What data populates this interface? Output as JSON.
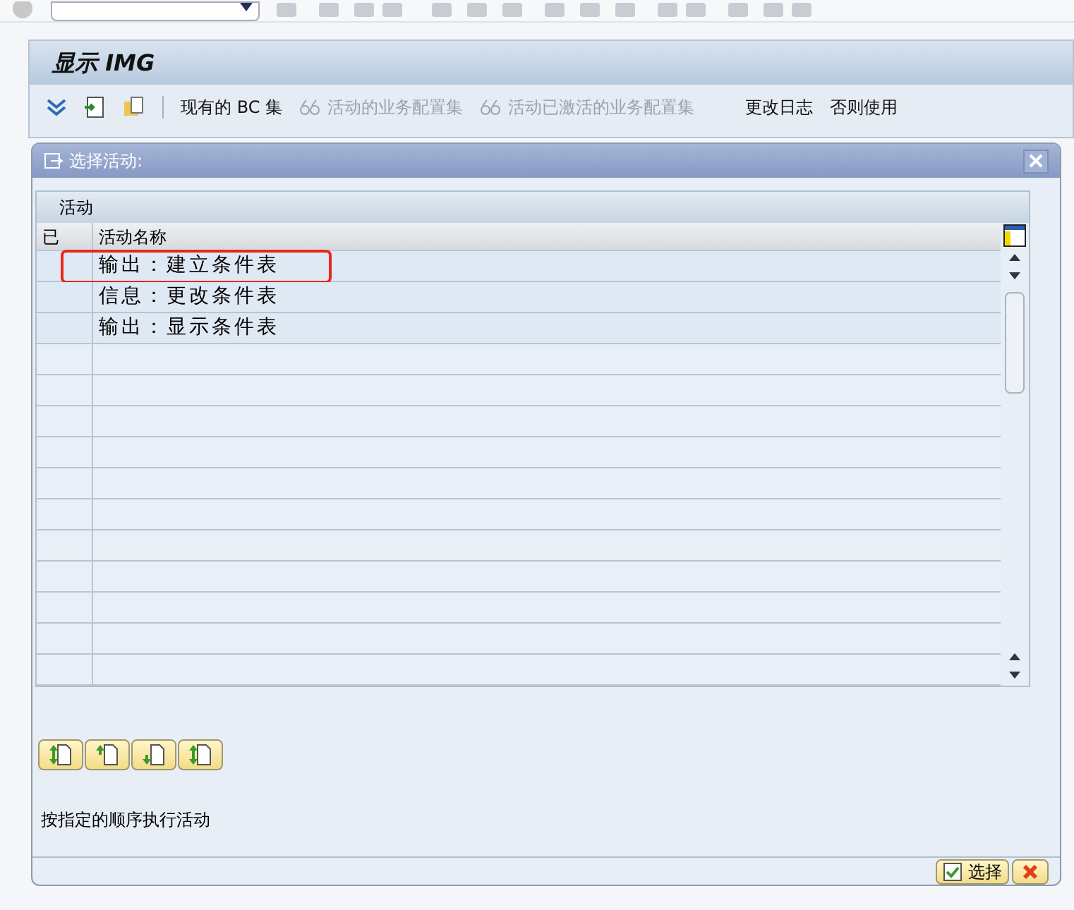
{
  "window": {
    "title": "显示 IMG"
  },
  "toolbar": {
    "items": [
      {
        "label": "现有的 BC 集",
        "disabled": false,
        "icon": false
      },
      {
        "label": "活动的业务配置集",
        "disabled": true,
        "icon": true
      },
      {
        "label": "活动已激活的业务配置集",
        "disabled": true,
        "icon": true
      },
      {
        "label": "更改日志",
        "disabled": false,
        "icon": false
      },
      {
        "label": "否则使用",
        "disabled": false,
        "icon": false
      }
    ]
  },
  "dialog": {
    "title": "选择活动:",
    "group_title": "活动",
    "columns": [
      "已",
      "活动名称"
    ],
    "rows": [
      {
        "name": "输出：建立条件表",
        "highlighted": true
      },
      {
        "name": "信息：更改条件表",
        "highlighted": false
      },
      {
        "name": "输出：显示条件表",
        "highlighted": false
      }
    ],
    "hint": "按指定的顺序执行活动",
    "select_button": "选择"
  }
}
